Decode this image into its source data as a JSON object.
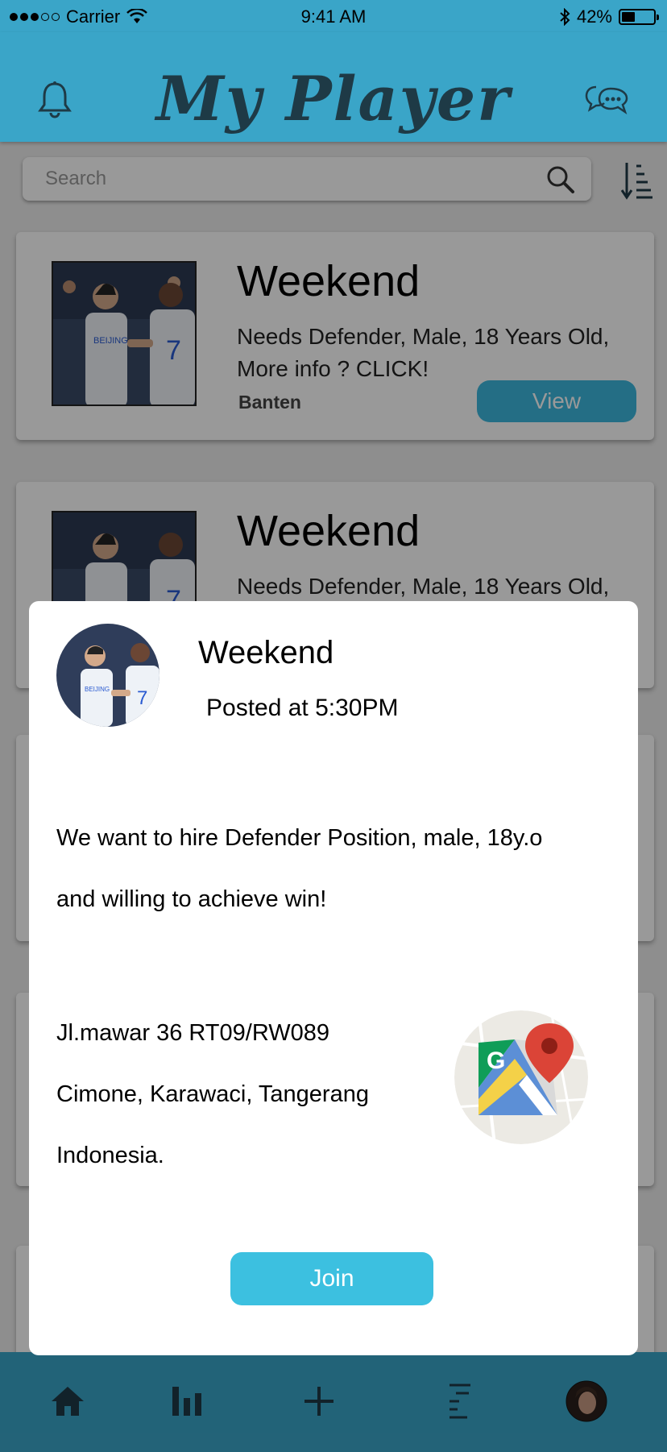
{
  "status_bar": {
    "carrier": "Carrier",
    "time": "9:41 AM",
    "battery": "42%",
    "battery_level": 0.42
  },
  "header": {
    "title": "My Player"
  },
  "search": {
    "placeholder": "Search"
  },
  "cards": [
    {
      "title": "Weekend",
      "description": "Needs Defender, Male, 18 Years Old, More info ? CLICK!",
      "location": "Banten",
      "button": "View"
    },
    {
      "title": "Weekend",
      "description": "Needs Defender, Male, 18 Years Old,"
    }
  ],
  "modal": {
    "title": "Weekend",
    "posted": "Posted at 5:30PM",
    "body_line1": "We want to hire Defender Position, male, 18y.o",
    "body_line2": "and willing to achieve win!",
    "address_line1": "Jl.mawar 36 RT09/RW089",
    "address_line2": "Cimone, Karawaci, Tangerang",
    "address_line3": "Indonesia.",
    "join_label": "Join"
  },
  "nav": {
    "items": [
      "home-icon",
      "stats-icon",
      "add-icon",
      "menu-icon",
      "profile-avatar"
    ]
  },
  "colors": {
    "primary": "#3aa5c8",
    "button": "#3cb8de",
    "title": "#1e3a46"
  }
}
